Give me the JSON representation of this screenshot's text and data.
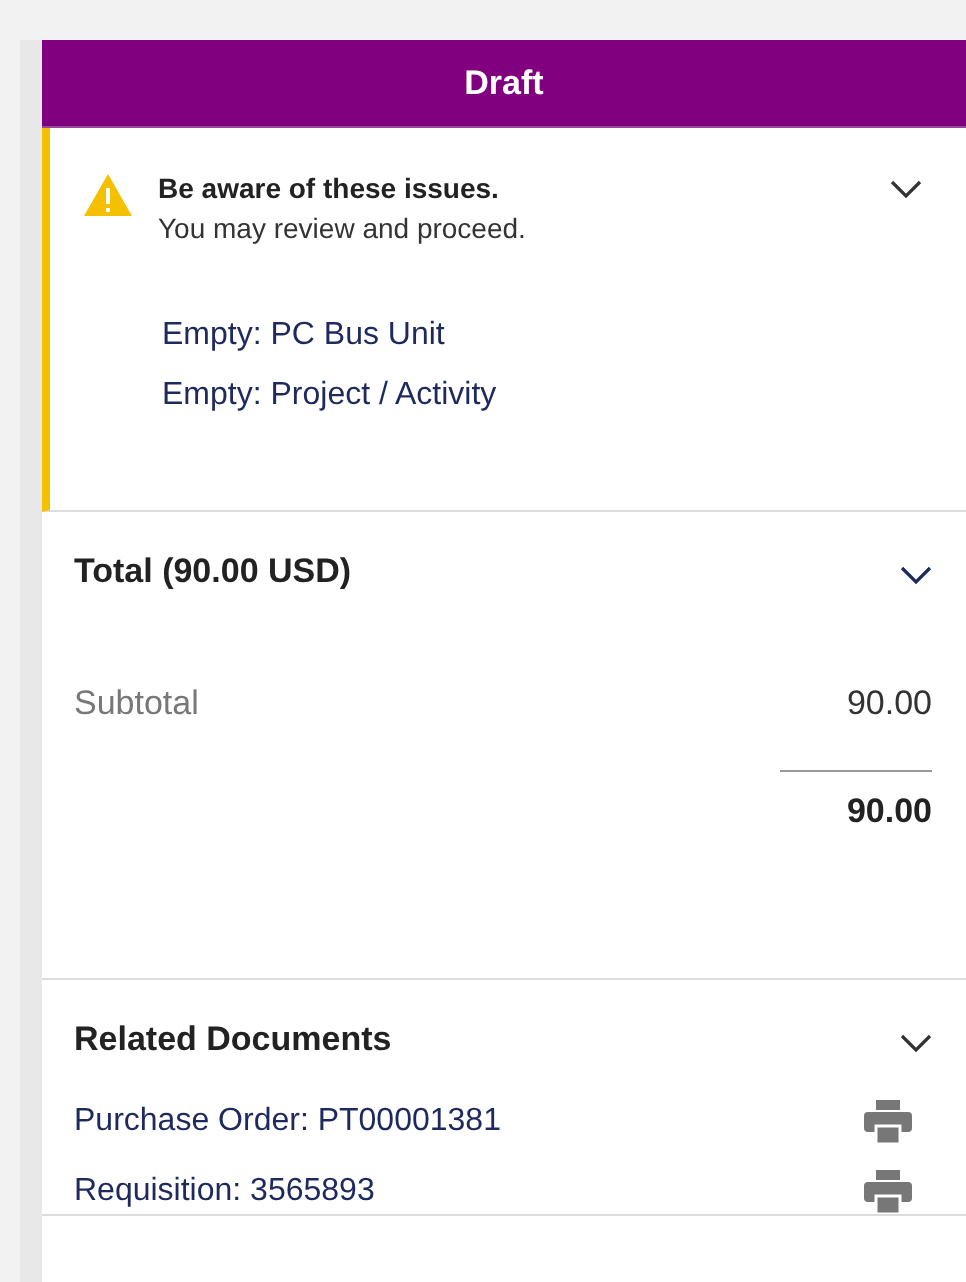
{
  "header": {
    "title": "Draft"
  },
  "warning": {
    "title": "Be aware of these issues.",
    "message": "You may review and proceed.",
    "issues": [
      "Empty: PC Bus Unit",
      "Empty: Project / Activity"
    ],
    "expanded": true
  },
  "total": {
    "title": "Total (90.00 USD)",
    "expanded": true,
    "rows": [
      {
        "label": "Subtotal",
        "value": "90.00"
      }
    ],
    "grand_total": "90.00"
  },
  "related": {
    "title": "Related Documents",
    "expanded": true,
    "documents": [
      "Purchase Order: PT00001381",
      "Requisition: 3565893"
    ]
  }
}
